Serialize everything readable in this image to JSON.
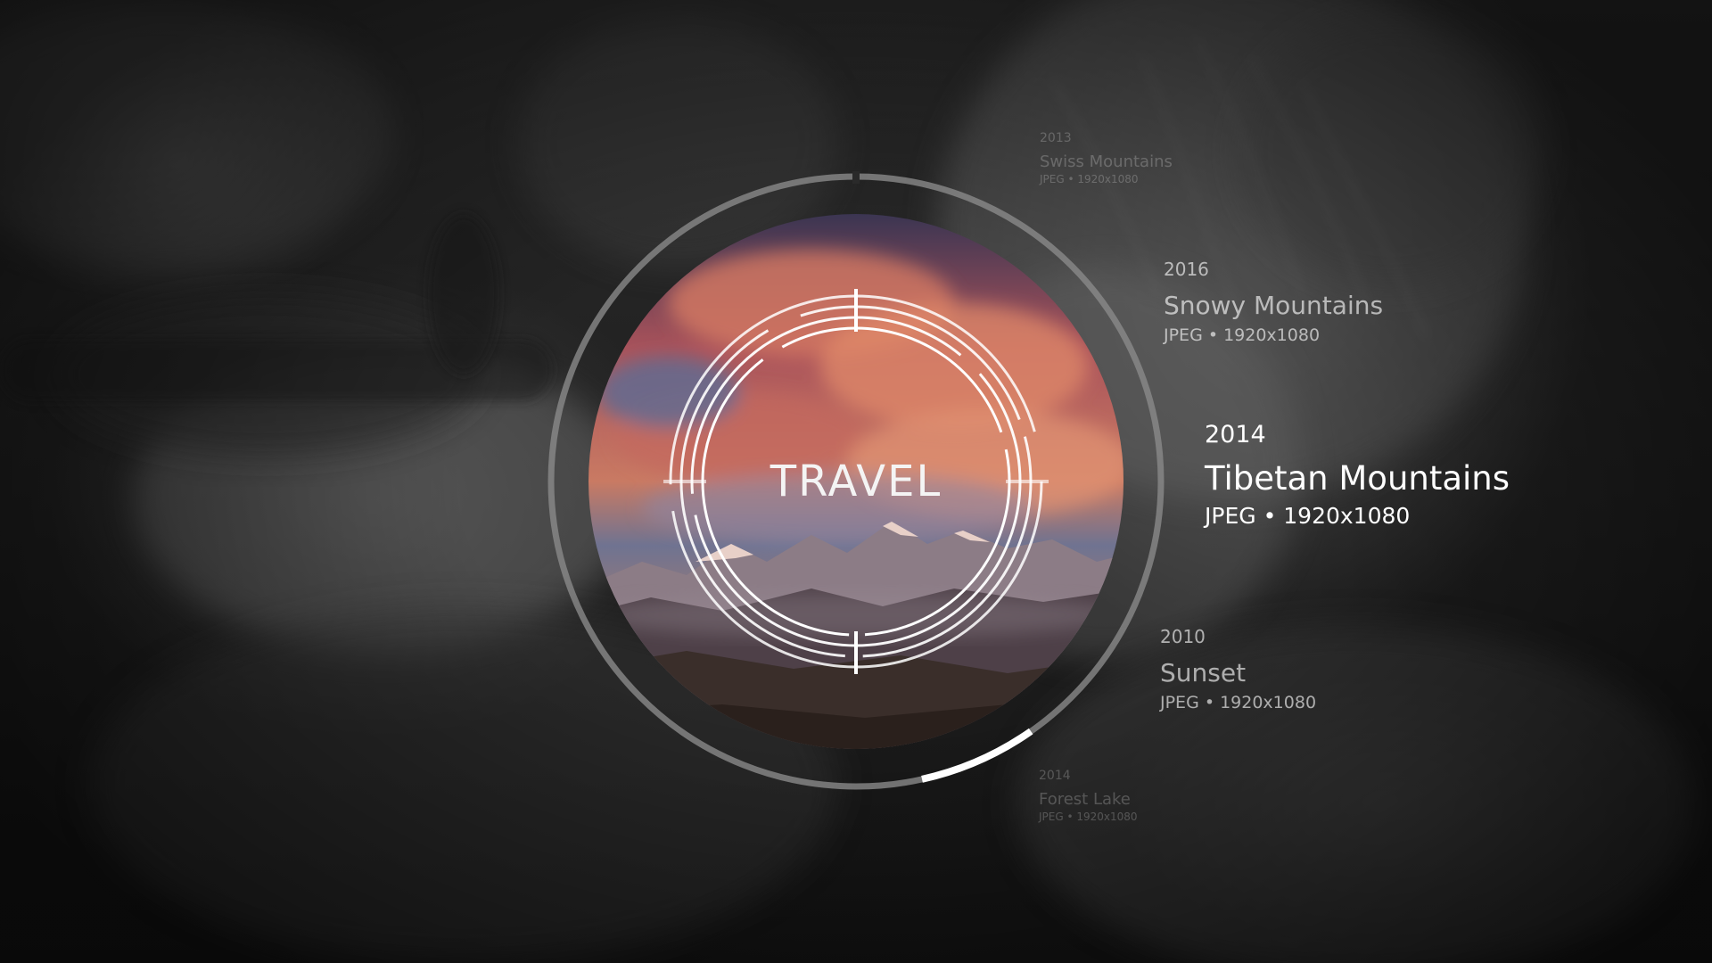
{
  "category": {
    "label": "TRAVEL"
  },
  "selection": {
    "index": 2,
    "progress": 0.125
  },
  "gallery": {
    "items": [
      {
        "year": "2013",
        "name": "Swiss Mountains",
        "meta": "JPEG • 1920x1080"
      },
      {
        "year": "2016",
        "name": "Snowy Mountains",
        "meta": "JPEG • 1920x1080"
      },
      {
        "year": "2014",
        "name": "Tibetan Mountains",
        "meta": "JPEG • 1920x1080"
      },
      {
        "year": "2010",
        "name": "Sunset",
        "meta": "JPEG • 1920x1080"
      },
      {
        "year": "2014",
        "name": "Forest Lake",
        "meta": "JPEG • 1920x1080"
      }
    ]
  },
  "colors": {
    "accent": "#ffffff",
    "ring": "#8a8a8a",
    "sky_top": "#3a3f5a",
    "sky_glow": "#d9775a"
  },
  "icons": {
    "background": "blurred-portrait-photo",
    "preview": "mountain-sunset-photo"
  }
}
